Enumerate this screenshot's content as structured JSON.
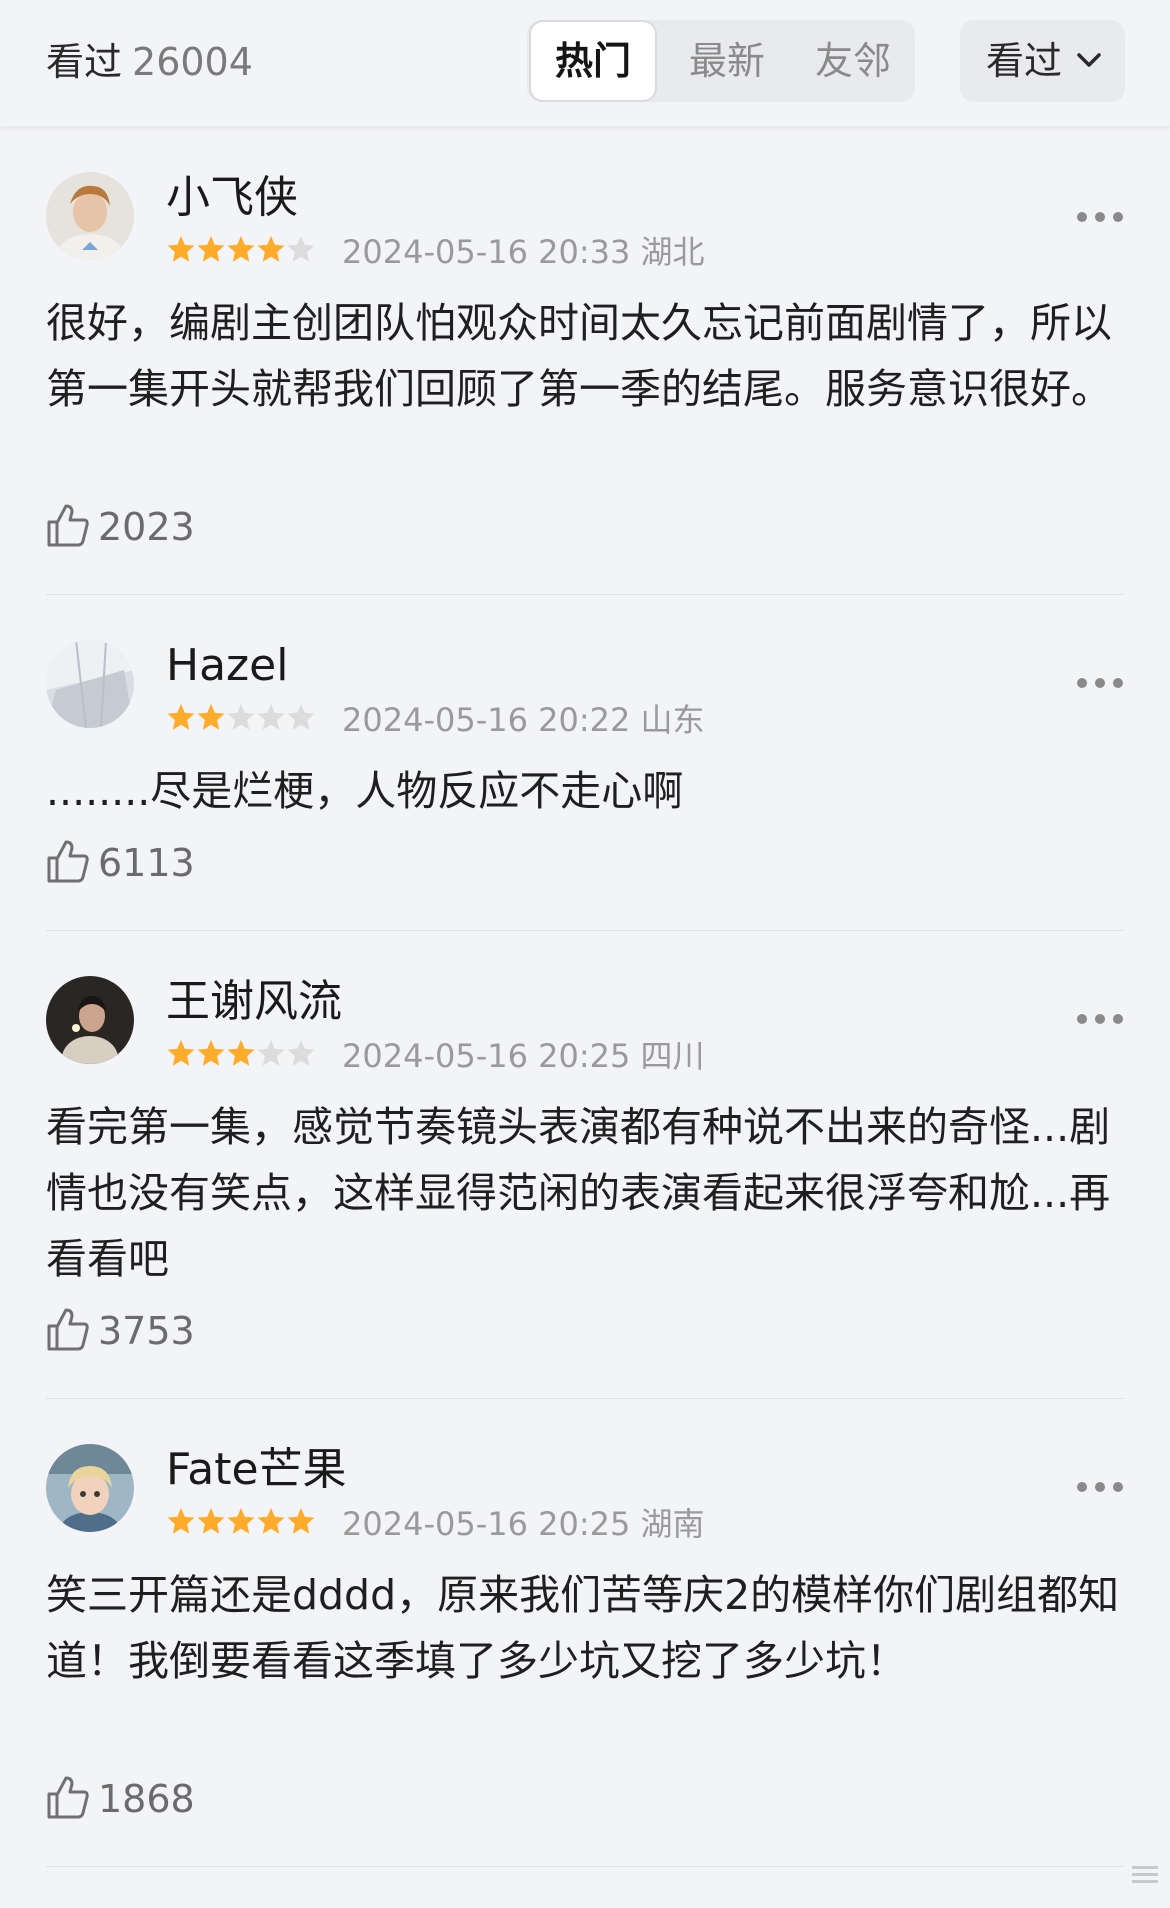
{
  "header": {
    "title": "看过",
    "count": "26004",
    "tabs": [
      "热门",
      "最新",
      "友邻"
    ],
    "filter_label": "看过"
  },
  "reviews": [
    {
      "username": "小飞侠",
      "rating": 4,
      "date": "2024-05-16 20:33",
      "location": "湖北",
      "content": "很好，编剧主创团队怕观众时间太久忘记前面剧情了，所以第一集开头就帮我们回顾了第一季的结尾。服务意识很好。",
      "likes": "2023"
    },
    {
      "username": "Hazel",
      "rating": 2,
      "date": "2024-05-16 20:22",
      "location": "山东",
      "content": "........尽是烂梗，人物反应不走心啊",
      "likes": "6113"
    },
    {
      "username": "王谢风流",
      "rating": 3,
      "date": "2024-05-16 20:25",
      "location": "四川",
      "content": "看完第一集，感觉节奏镜头表演都有种说不出来的奇怪...剧情也没有笑点，这样显得范闲的表演看起来很浮夸和尬...再看看吧",
      "likes": "3753"
    },
    {
      "username": "Fate芒果",
      "rating": 5,
      "date": "2024-05-16 20:25",
      "location": "湖南",
      "content": "笑三开篇还是dddd，原来我们苦等庆2的模样你们剧组都知道！我倒要看看这季填了多少坑又挖了多少坑！",
      "likes": "1868"
    }
  ],
  "colors": {
    "background": "#f3f4f8",
    "star_filled": "#ffac2d",
    "star_empty": "#dcdcdc",
    "meta_text": "#9a9a9a"
  },
  "icons": {
    "more": "more-dots-icon",
    "like": "thumbs-up-icon",
    "star": "star-icon",
    "dropdown": "chevron-down-icon"
  }
}
